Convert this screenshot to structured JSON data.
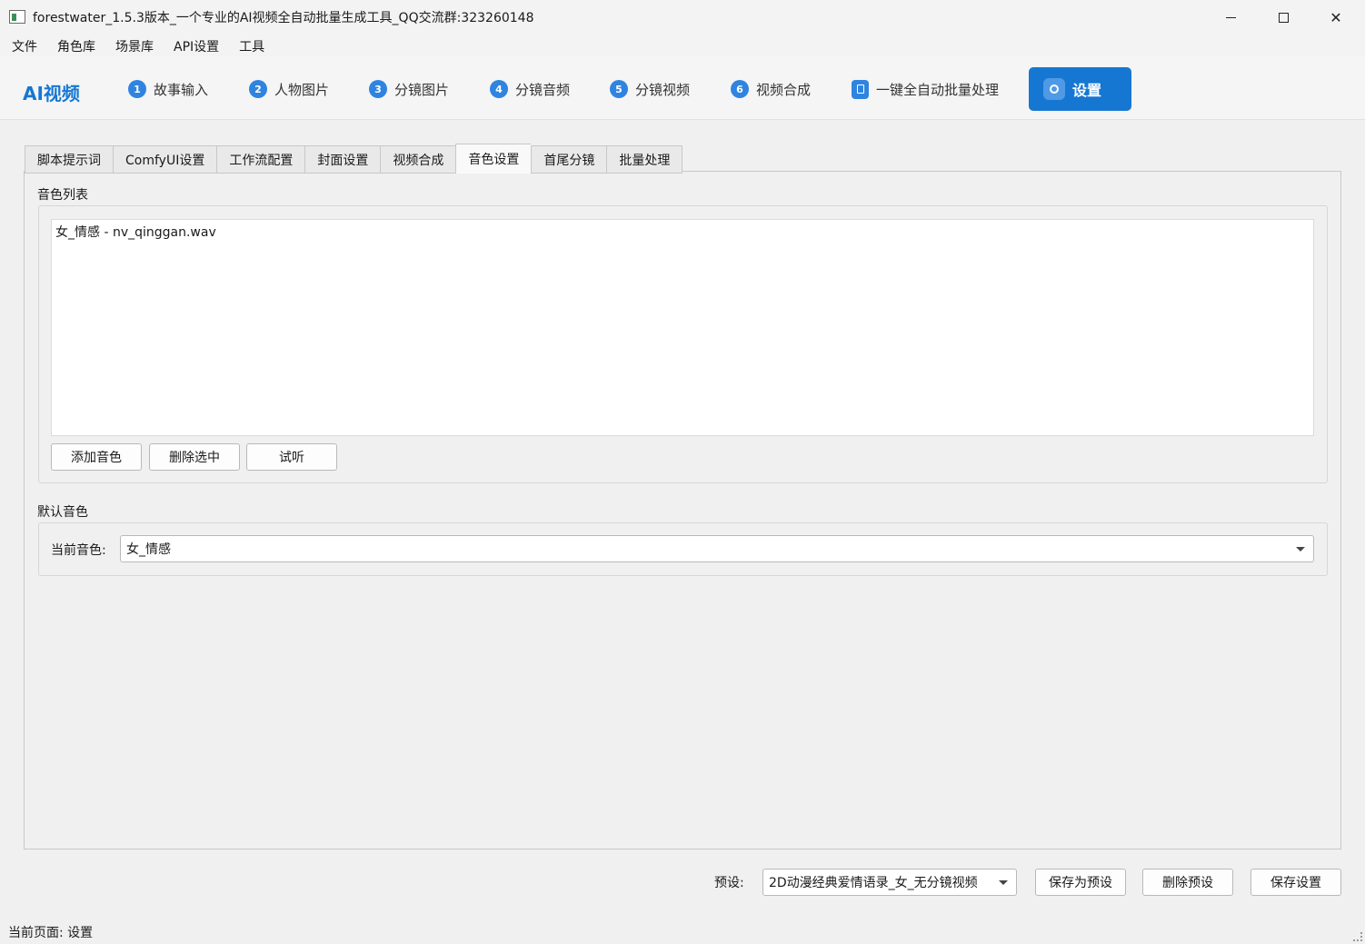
{
  "window": {
    "title": "forestwater_1.5.3版本_一个专业的AI视频全自动批量生成工具_QQ交流群:323260148"
  },
  "menu": [
    "文件",
    "角色库",
    "场景库",
    "API设置",
    "工具"
  ],
  "header": {
    "brand": "AI视频",
    "steps": [
      {
        "num": "1",
        "label": "故事输入"
      },
      {
        "num": "2",
        "label": "人物图片"
      },
      {
        "num": "3",
        "label": "分镜图片"
      },
      {
        "num": "4",
        "label": "分镜音频"
      },
      {
        "num": "5",
        "label": "分镜视频"
      },
      {
        "num": "6",
        "label": "视频合成"
      }
    ],
    "batch_label": "一键全自动批量处理",
    "settings_label": "设置",
    "accent_color": "#1677d2"
  },
  "tabs": [
    "脚本提示词",
    "ComfyUI设置",
    "工作流配置",
    "封面设置",
    "视频合成",
    "音色设置",
    "首尾分镜",
    "批量处理"
  ],
  "active_tab": "音色设置",
  "voice_list": {
    "title": "音色列表",
    "items": [
      "女_情感 - nv_qinggan.wav"
    ],
    "add_button": "添加音色",
    "delete_button": "删除选中",
    "listen_button": "试听"
  },
  "default_voice": {
    "title": "默认音色",
    "current_label": "当前音色:",
    "current_value": "女_情感"
  },
  "footer": {
    "preset_label": "预设:",
    "preset_value": "2D动漫经典爱情语录_女_无分镜视频",
    "save_as_preset": "保存为预设",
    "delete_preset": "删除预设",
    "save_settings": "保存设置"
  },
  "status": "当前页面: 设置"
}
